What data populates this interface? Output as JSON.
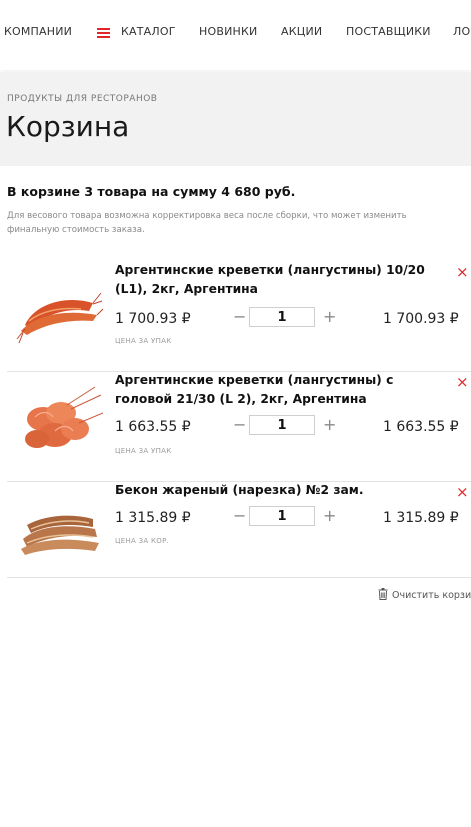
{
  "nav": {
    "items": [
      "КОМПАНИИ",
      "КАТАЛОГ",
      "НОВИНКИ",
      "АКЦИИ",
      "ПОСТАВЩИКИ",
      "ЛО"
    ]
  },
  "breadcrumb": "ПРОДУКТЫ ДЛЯ РЕСТОРАНОВ",
  "page_title": "Корзина",
  "summary": "В корзине 3 товара на сумму 4 680 руб.",
  "note": "Для весового товара возможна корректировка веса после сборки, что может изменить финальную стоимость заказа.",
  "items": [
    {
      "name": "Аргентинские креветки (лангустины) 10/20 (L1), 2кг, Аргентина",
      "price": "1 700.93 ₽",
      "unit": "ЦЕНА ЗА УПАК",
      "qty": "1",
      "total": "1 700.93 ₽"
    },
    {
      "name": "Аргентинские креветки (лангустины) с головой 21/30 (L 2), 2кг, Аргентина",
      "price": "1 663.55 ₽",
      "unit": "ЦЕНА ЗА УПАК",
      "qty": "1",
      "total": "1 663.55 ₽"
    },
    {
      "name": "Бекон жареный (нарезка) №2 зам.",
      "price": "1 315.89 ₽",
      "unit": "ЦЕНА ЗА КОР.",
      "qty": "1",
      "total": "1 315.89 ₽"
    }
  ],
  "controls": {
    "minus": "−",
    "plus": "+",
    "remove": "×"
  },
  "clear_label": "Очистить корзи",
  "icons": [
    "menu-icon",
    "close-icon",
    "trash-icon"
  ],
  "colors": {
    "accent": "#e1262b",
    "header_bg": "#f2f2f2"
  }
}
